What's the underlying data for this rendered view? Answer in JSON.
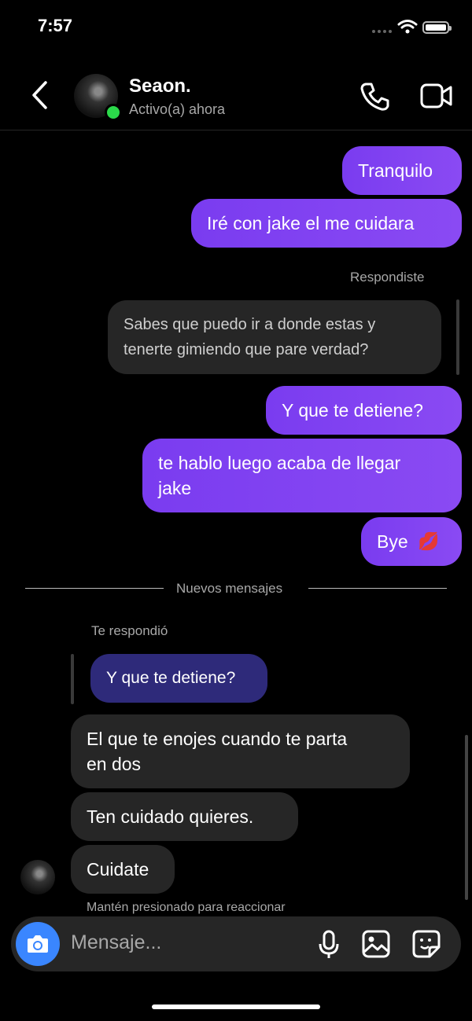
{
  "status_bar": {
    "time": "7:57"
  },
  "header": {
    "contact_name": "Seaon.",
    "status": "Activo(a) ahora",
    "icons": [
      "back-icon",
      "phone-icon",
      "video-icon"
    ]
  },
  "messages": {
    "m1": "Tranquilo",
    "m2": "Iré con jake el me cuidara",
    "reply_label_sent": "Respondiste",
    "quoted_recv_line1": "Sabes que puedo ir a donde estas y",
    "quoted_recv_line2": "tenerte gimiendo que pare verdad?",
    "m3": "Y que te detiene?",
    "m4_line1": "te hablo luego acaba de llegar",
    "m4_line2": "jake",
    "m5": "Bye",
    "m5_emoji": "💋",
    "new_messages": "Nuevos mensajes",
    "reply_label_recv": "Te respondió",
    "quoted_sent": "Y que te detiene?",
    "r1_line1": "El que te enojes cuando te parta",
    "r1_line2": "en dos",
    "r2": "Ten cuidado quieres.",
    "r3": "Cuidate",
    "hint": "Mantén presionado para reaccionar"
  },
  "composer": {
    "placeholder": "Mensaje...",
    "icons": [
      "camera-icon",
      "microphone-icon",
      "gallery-icon",
      "sticker-icon"
    ]
  },
  "colors": {
    "sent_bubble": "#7a3cf0",
    "recv_bubble": "#262626",
    "camera_button": "#3a86ff",
    "online": "#2bd94a"
  }
}
